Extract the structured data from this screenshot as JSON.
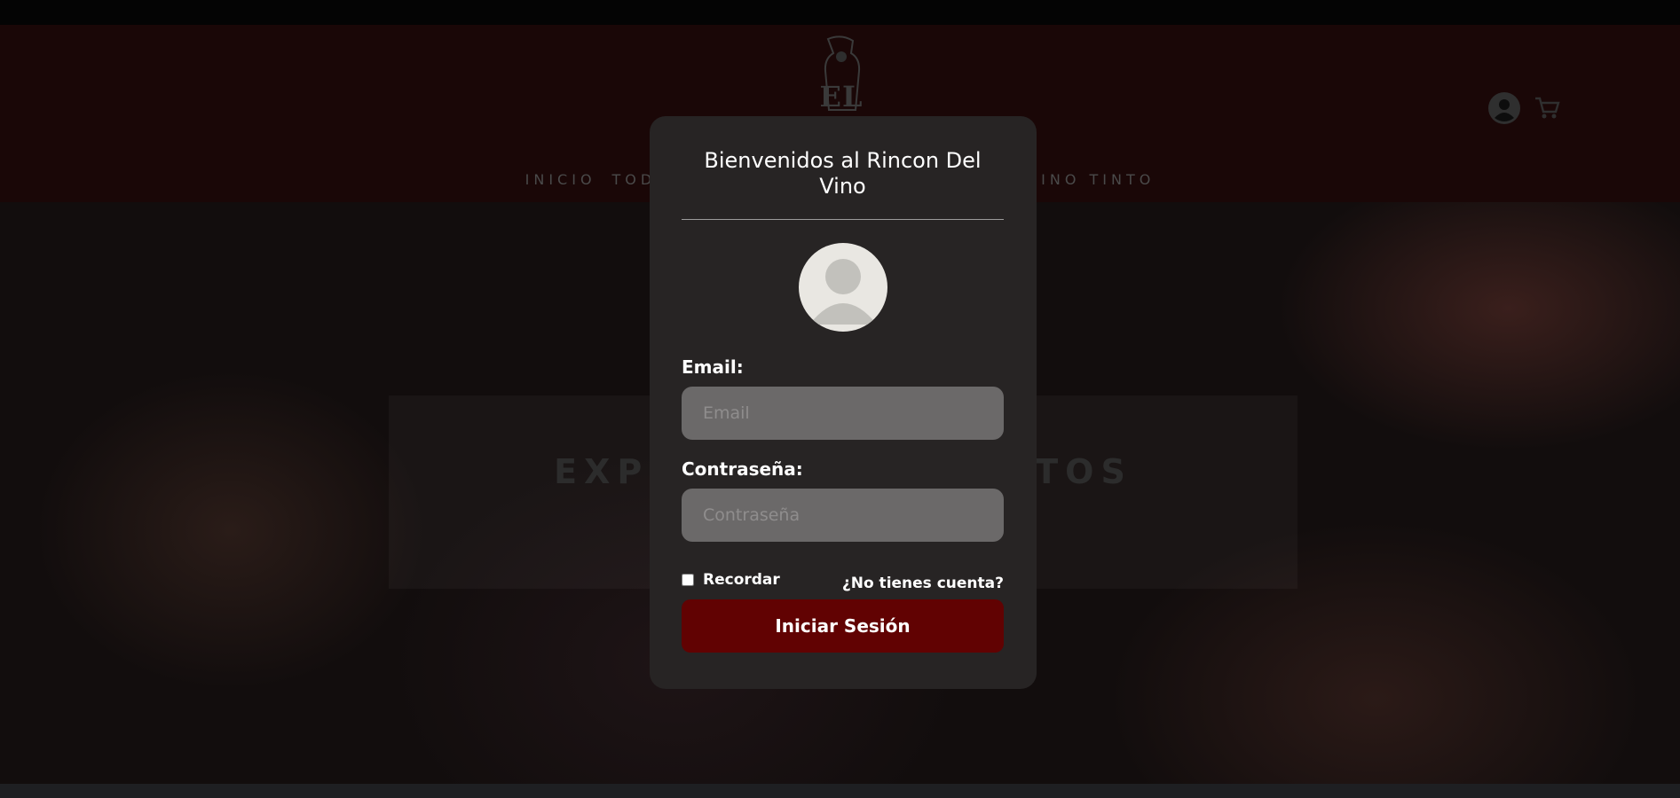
{
  "site": {
    "logo_text": "EL RINCON",
    "nav": [
      {
        "label": "INICIO"
      },
      {
        "label": "TOD"
      },
      {
        "label": "VINO TINTO"
      }
    ],
    "hero_title": "EXPLOR          DUCTOS",
    "icons": {
      "account": "user-circle-icon",
      "cart": "cart-icon"
    }
  },
  "login_modal": {
    "title": "Bienvenidos al Rincon Del Vino",
    "avatar_icon": "user-avatar-icon",
    "email": {
      "label": "Email:",
      "placeholder": "Email",
      "value": ""
    },
    "password": {
      "label": "Contraseña:",
      "placeholder": "Contraseña",
      "value": ""
    },
    "remember": {
      "label": "Recordar",
      "checked": false
    },
    "signup_link": "¿No tienes cuenta?",
    "submit_label": "Iniciar Sesión"
  },
  "colors": {
    "modal_bg": "#272424",
    "input_bg": "#6b6969",
    "button_bg": "#610202",
    "header_bg": "#1a0707"
  }
}
